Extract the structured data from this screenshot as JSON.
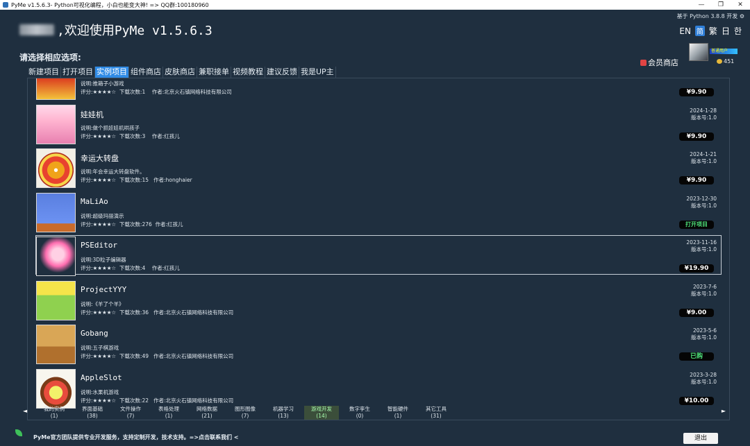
{
  "window": {
    "title": "PyMe v1.5.6.3- Python可视化编程，小白也能变大神! => QQ群:100180960",
    "minimize": "—",
    "restore": "❐",
    "close": "✕"
  },
  "header": {
    "welcome": ",欢迎使用PyMe v1.5.6.3",
    "python_info": "基于 Python 3.8.8 开发 ⚙",
    "languages": [
      "EN",
      "简",
      "繁",
      "日",
      "한"
    ],
    "active_language": "简",
    "user_level": "普通用户",
    "coins": "451",
    "vip_shop": "会员商店",
    "prompt": "请选择相应选项:"
  },
  "tabs": [
    "新建项目",
    "打开项目",
    "实例项目",
    "组件商店",
    "皮肤商店",
    "兼职接单",
    "视频教程",
    "建议反馈",
    "我是UP主"
  ],
  "active_tab": "实例项目",
  "items": [
    {
      "name": "",
      "desc": "说明:推箱子小游戏",
      "meta": "评分:★★★★☆  下载次数:1    作者:北京火石镇网络科技有限公司",
      "date": "",
      "version": "",
      "price": "¥9.90",
      "price_kind": "price",
      "art": "t-red"
    },
    {
      "name": "娃娃机",
      "desc": "说明:做个抓娃娃机哄孩子",
      "meta": "评分:★★★★☆  下载次数:3    作者:红孩儿",
      "date": "2024-1-28",
      "version": "版本号:1.0",
      "price": "¥9.90",
      "price_kind": "price",
      "art": "t-claw"
    },
    {
      "name": "幸运大转盘",
      "desc": "说明:年会幸运大转盘软件。",
      "meta": "评分:★★★★☆  下载次数:15   作者:honghaier",
      "date": "2024-1-21",
      "version": "版本号:1.0",
      "price": "¥9.90",
      "price_kind": "price",
      "art": "t-wheel"
    },
    {
      "name": "MaLiAo",
      "desc": "说明:超级玛丽演示",
      "meta": "评分:★★★★☆  下载次数:276  作者:红孩儿",
      "date": "2023-12-30",
      "version": "版本号:1.0",
      "price": "打开项目",
      "price_kind": "open",
      "art": "t-mario"
    },
    {
      "name": "PSEditor",
      "desc": "说明:3D粒子编辑器",
      "meta": "评分:★★★★☆  下载次数:4    作者:红孩儿",
      "date": "2023-11-16",
      "version": "版本号:1.0",
      "price": "¥19.90",
      "price_kind": "price",
      "art": "t-petal",
      "highlight": true
    },
    {
      "name": "ProjectYYY",
      "desc": "说明:《羊了个羊》",
      "meta": "评分:★★★★☆  下载次数:36   作者:北京火石镇网络科技有限公司",
      "date": "2023-7-6",
      "version": "版本号:1.0",
      "price": "¥9.00",
      "price_kind": "price",
      "art": "t-sheep"
    },
    {
      "name": "Gobang",
      "desc": "说明:五子棋游戏",
      "meta": "评分:★★★★☆  下载次数:49   作者:北京火石镇网络科技有限公司",
      "date": "2023-5-6",
      "version": "版本号:1.0",
      "price": "已购",
      "price_kind": "bought",
      "art": "t-gobang"
    },
    {
      "name": "AppleSlot",
      "desc": "说明:水果机游戏",
      "meta": "评分:★★★★☆  下载次数:22   作者:北京火石镇网络科技有限公司",
      "date": "2023-3-28",
      "version": "版本号:1.0",
      "price": "¥10.00",
      "price_kind": "price",
      "art": "t-fruit"
    }
  ],
  "categories": [
    {
      "label": "我的实例",
      "count": "(1)"
    },
    {
      "label": "界面基础",
      "count": "(38)"
    },
    {
      "label": "文件操作",
      "count": "(7)"
    },
    {
      "label": "表格处理",
      "count": "(1)"
    },
    {
      "label": "网络数据",
      "count": "(21)"
    },
    {
      "label": "图形图像",
      "count": "(7)"
    },
    {
      "label": "机器学习",
      "count": "(13)"
    },
    {
      "label": "游戏开发",
      "count": "(14)"
    },
    {
      "label": "数字孪生",
      "count": "(0)"
    },
    {
      "label": "智能硬件",
      "count": "(1)"
    },
    {
      "label": "其它工具",
      "count": "(31)"
    }
  ],
  "active_category": "游戏开发",
  "nav": {
    "prev": "◄",
    "next": "►"
  },
  "footer": {
    "message": "PyMe官方团队提供专业开发服务，支持定制开发，技术支持。=>点击联系我们 <",
    "exit": "退出"
  }
}
